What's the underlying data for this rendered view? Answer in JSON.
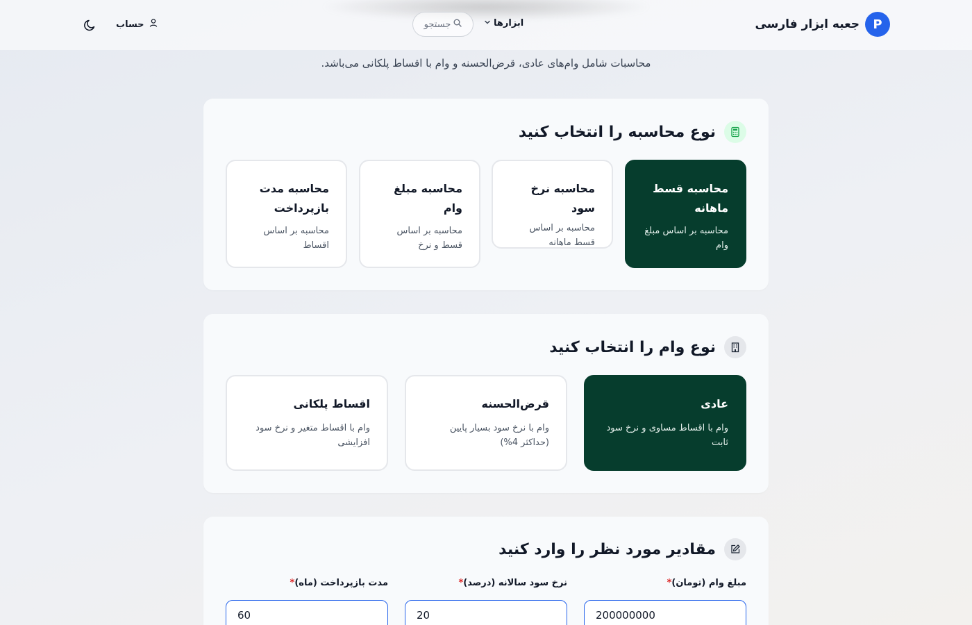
{
  "header": {
    "brand_name": "جعبه ابزار فارسی",
    "brand_logo_letter": "P",
    "tools_label": "ابزارها",
    "search_placeholder": "جستجو",
    "account_label": "حساب"
  },
  "intro": {
    "text": "محاسبات شامل وام‌های عادی، قرض‌الحسنه و وام با اقساط پلکانی می‌باشد."
  },
  "calc_type": {
    "title": "نوع محاسبه را انتخاب کنید",
    "options": [
      {
        "title": "محاسبه قسط ماهانه",
        "desc": "محاسبه بر اساس مبلغ وام",
        "active": true
      },
      {
        "title": "محاسبه نرخ سود",
        "desc": "محاسبه بر اساس قسط ماهانه",
        "active": false
      },
      {
        "title": "محاسبه مبلغ وام",
        "desc": "محاسبه بر اساس قسط و نرخ",
        "active": false
      },
      {
        "title": "محاسبه مدت بازپرداخت",
        "desc": "محاسبه بر اساس اقساط",
        "active": false
      }
    ]
  },
  "loan_type": {
    "title": "نوع وام را انتخاب کنید",
    "options": [
      {
        "title": "عادی",
        "desc": "وام با اقساط مساوی و نرخ سود ثابت",
        "active": true
      },
      {
        "title": "قرض‌الحسنه",
        "desc": "وام با نرخ سود بسیار پایین (حداکثر 4%)",
        "active": false
      },
      {
        "title": "اقساط پلکانی",
        "desc": "وام با اقساط متغیر و نرخ سود افزایشی",
        "active": false
      }
    ]
  },
  "inputs": {
    "title": "مقادیر مورد نظر را وارد کنید",
    "required_mark": "*",
    "fields": [
      {
        "label": "مبلغ وام (تومان)",
        "value": "200000000"
      },
      {
        "label": "نرخ سود سالانه (درصد)",
        "value": "20"
      },
      {
        "label": "مدت بازپرداخت (ماه)",
        "value": "60"
      }
    ]
  },
  "colors": {
    "accent": "#2563eb",
    "active_card": "#063d2d",
    "required": "#dc2626"
  },
  "icons": {
    "calc_type": "calculator-icon",
    "loan_type": "building-icon",
    "inputs": "edit-icon"
  }
}
